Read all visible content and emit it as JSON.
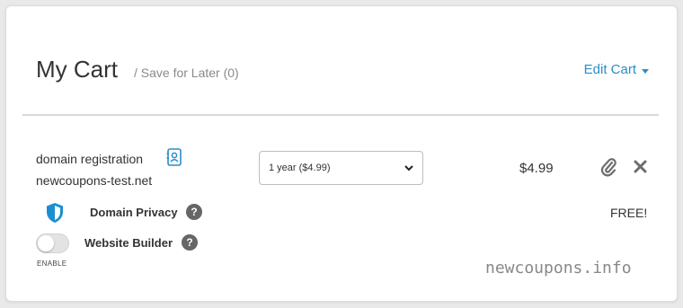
{
  "header": {
    "title": "My Cart",
    "save_for_later": "/ Save for Later (0)",
    "edit_cart": "Edit Cart"
  },
  "item": {
    "product_type": "domain registration",
    "domain": "newcoupons-test.net",
    "term_selected": "1 year ($4.99)",
    "price": "$4.99",
    "addons": [
      {
        "label": "Domain Privacy",
        "price": "FREE!",
        "icon": "shield-icon"
      },
      {
        "label": "Website Builder",
        "toggle_caption": "ENABLE",
        "enabled": false
      }
    ]
  },
  "watermark": "newcoupons.info",
  "colors": {
    "link": "#2a8ec9",
    "shield": "#1b8fd1",
    "help_icon": "#666666"
  }
}
